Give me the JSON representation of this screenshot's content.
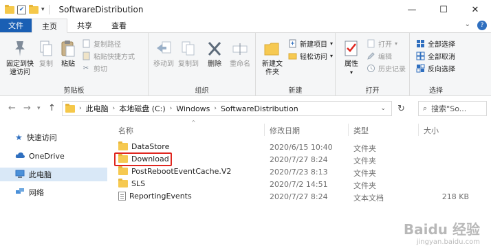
{
  "window": {
    "title": "SoftwareDistribution",
    "minimize": "—",
    "maximize": "☐",
    "close": "✕"
  },
  "tabs": [
    {
      "label": "文件"
    },
    {
      "label": "主页"
    },
    {
      "label": "共享"
    },
    {
      "label": "查看"
    }
  ],
  "ribbon": {
    "clipboard": {
      "pin": "固定到快速访问",
      "copy": "复制",
      "paste": "粘贴",
      "copy_path": "复制路径",
      "paste_shortcut": "粘贴快捷方式",
      "cut": "剪切",
      "label": "剪贴板"
    },
    "organize": {
      "move_to": "移动到",
      "copy_to": "复制到",
      "delete": "删除",
      "rename": "重命名",
      "label": "组织"
    },
    "new": {
      "new_folder": "新建文件夹",
      "new_item": "新建项目",
      "easy_access": "轻松访问",
      "label": "新建"
    },
    "open": {
      "properties": "属性",
      "open": "打开",
      "edit": "编辑",
      "history": "历史记录",
      "label": "打开"
    },
    "select": {
      "select_all": "全部选择",
      "select_none": "全部取消",
      "invert": "反向选择",
      "label": "选择"
    }
  },
  "address": {
    "crumbs": [
      "此电脑",
      "本地磁盘 (C:)",
      "Windows",
      "SoftwareDistribution"
    ],
    "search_placeholder": "搜索\"So..."
  },
  "navpane": [
    {
      "label": "快速访问",
      "icon": "star-icon"
    },
    {
      "label": "OneDrive",
      "icon": "cloud-icon"
    },
    {
      "label": "此电脑",
      "icon": "computer-icon"
    },
    {
      "label": "网络",
      "icon": "network-icon"
    }
  ],
  "columns": {
    "name": "名称",
    "date": "修改日期",
    "type": "类型",
    "size": "大小"
  },
  "files": [
    {
      "name": "DataStore",
      "date": "2020/6/15 10:40",
      "type": "文件夹",
      "size": ""
    },
    {
      "name": "Download",
      "date": "2020/7/27 8:24",
      "type": "文件夹",
      "size": ""
    },
    {
      "name": "PostRebootEventCache.V2",
      "date": "2020/7/23 8:13",
      "type": "文件夹",
      "size": ""
    },
    {
      "name": "SLS",
      "date": "2020/7/2 14:51",
      "type": "文件夹",
      "size": ""
    },
    {
      "name": "ReportingEvents",
      "date": "2020/7/27 8:24",
      "type": "文本文档",
      "size": "218 KB"
    }
  ],
  "watermark": {
    "main": "Baidu 经验",
    "sub": "jingyan.baidu.com"
  }
}
